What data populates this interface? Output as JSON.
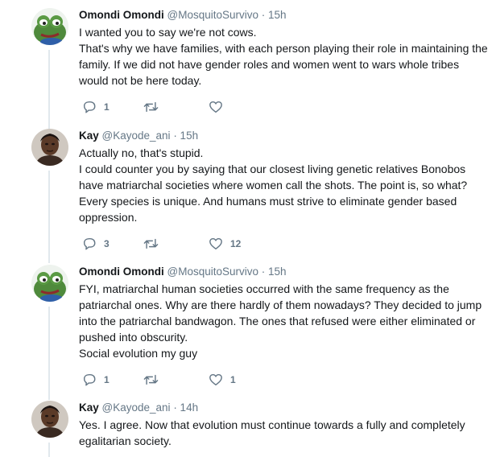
{
  "tweets": [
    {
      "name": "Omondi Omondi",
      "handle": "@MosquitoSurvivo",
      "time": "· 15h",
      "avatar": "frog-avatar",
      "lines": [
        "I wanted you to say we're not cows.",
        "That's why we have families, with each person playing their role in maintaining the family. If we did not have gender roles and women went to wars whole tribes would not be here today."
      ],
      "replies": "1",
      "retweets": "",
      "likes": ""
    },
    {
      "name": "Kay",
      "handle": "@Kayode_ani",
      "time": "· 15h",
      "avatar": "person-avatar",
      "lines": [
        "Actually no, that's stupid.",
        "I could counter you by saying that our closest living genetic relatives Bonobos have matriarchal societies where women call the shots. The point is, so what? Every species is unique. And humans must strive to eliminate gender based oppression."
      ],
      "replies": "3",
      "retweets": "",
      "likes": "12"
    },
    {
      "name": "Omondi Omondi",
      "handle": "@MosquitoSurvivo",
      "time": "· 15h",
      "avatar": "frog-avatar",
      "lines": [
        "FYI, matriarchal human societies occurred with the same frequency as the patriarchal ones. Why are there hardly of them nowadays? They decided to jump into the patriarchal bandwagon. The ones that refused were either eliminated or pushed into obscurity.",
        "Social evolution my guy"
      ],
      "replies": "1",
      "retweets": "",
      "likes": "1"
    },
    {
      "name": "Kay",
      "handle": "@Kayode_ani",
      "time": "· 14h",
      "avatar": "person-avatar",
      "lines": [
        "Yes. I agree. Now that evolution must continue towards a fully and completely egalitarian society."
      ]
    }
  ],
  "icons": {
    "reply": "reply-icon",
    "retweet": "retweet-icon",
    "like": "heart-icon"
  },
  "colors": {
    "text": "#14171a",
    "muted": "#657786",
    "thread": "#e1e8ed"
  }
}
